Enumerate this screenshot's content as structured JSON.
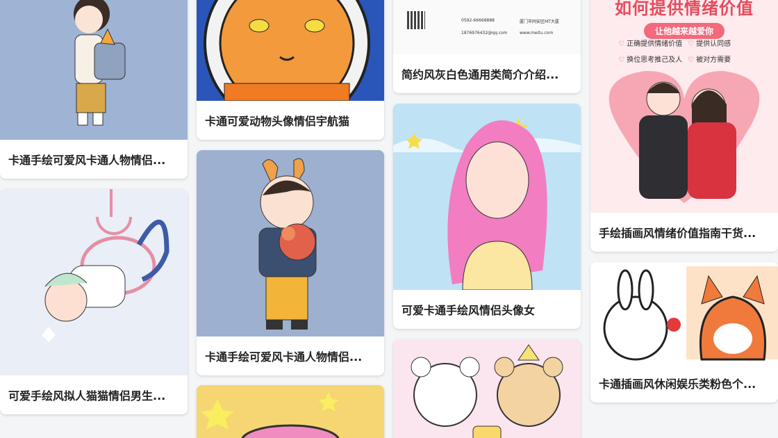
{
  "cards": {
    "c1": {
      "title": "卡通手绘可爱风卡通人物情侣..."
    },
    "c2": {
      "title": "可爱手绘风拟人猫猫情侣男生..."
    },
    "c3": {
      "title": "卡通可爱动物头像情侣宇航猫"
    },
    "c4": {
      "title": "卡通手绘可爱风卡通人物情侣..."
    },
    "c5": {
      "title": "简约风灰白色通用类简介介绍...",
      "phone": "0592-66668888",
      "address": "厦门市同安区MT大厦",
      "email": "1876976432@qq.com",
      "website": "www.meitu.com"
    },
    "c6": {
      "title": "可爱卡通手绘风情侣头像女"
    },
    "c7": {
      "title": "手绘插画风情绪价值指南干货...",
      "poster_title": "如何提供情绪价值",
      "poster_sub": "让他越来越爱你",
      "tips": [
        "正确提供情绪价值",
        "提供认同感",
        "换位思考推己及人",
        "被对方需要"
      ]
    },
    "c8": {
      "title": "卡通插画风休闲娱乐类粉色个..."
    }
  },
  "colors": {
    "background": "#f4f5f7",
    "accent": "#e64b5d"
  }
}
